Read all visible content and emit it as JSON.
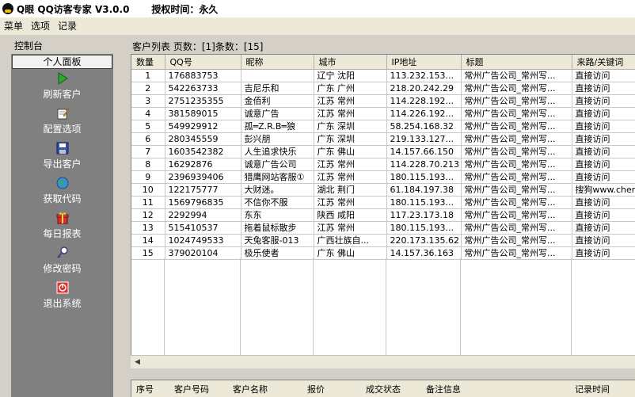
{
  "titlebar": {
    "title": "Q眼 QQ访客专家 V3.0.0",
    "license_label": "授权时间：永久"
  },
  "menu": [
    "菜单",
    "选项",
    "记录"
  ],
  "control_panel": {
    "label": "控制台",
    "header": "个人面板",
    "items": [
      {
        "label": "刷新客户",
        "icon": "play-icon"
      },
      {
        "label": "配置选项",
        "icon": "edit-icon"
      },
      {
        "label": "导出客户",
        "icon": "save-icon"
      },
      {
        "label": "获取代码",
        "icon": "globe-icon"
      },
      {
        "label": "每日报表",
        "icon": "gift-icon"
      },
      {
        "label": "修改密码",
        "icon": "key-icon"
      },
      {
        "label": "退出系统",
        "icon": "exit-icon"
      }
    ]
  },
  "customer_list": {
    "title": "客户列表 页数：[1]条数：[15]",
    "columns": [
      "数量",
      "QQ号",
      "昵称",
      "城市",
      "IP地址",
      "标题",
      "来路/关键词"
    ],
    "rows": [
      [
        "1",
        "176883753",
        "",
        "辽宁 沈阳",
        "113.232.153...",
        "常州广告公司_常州写...",
        "直接访问"
      ],
      [
        "2",
        "542263733",
        "吉尼乐和",
        "广东 广州",
        "218.20.242.29",
        "常州广告公司_常州写...",
        "直接访问"
      ],
      [
        "3",
        "2751235355",
        "金佰利",
        "江苏 常州",
        "114.228.192...",
        "常州广告公司_常州写...",
        "直接访问"
      ],
      [
        "4",
        "381589015",
        "诚意广告",
        "江苏 常州",
        "114.226.192...",
        "常州广告公司_常州写...",
        "直接访问"
      ],
      [
        "5",
        "549929912",
        "孤═Z.R.B═狼",
        "广东 深圳",
        "58.254.168.32",
        "常州广告公司_常州写...",
        "直接访问"
      ],
      [
        "6",
        "280345559",
        "彭兴朋",
        "广东 深圳",
        "219.133.127...",
        "常州广告公司_常州写...",
        "直接访问"
      ],
      [
        "7",
        "1603542382",
        "人生追求快乐",
        "广东 佛山",
        "14.157.66.150",
        "常州广告公司_常州写...",
        "直接访问"
      ],
      [
        "8",
        "16292876",
        "诚意广告公司",
        "江苏 常州",
        "114.228.70.213",
        "常州广告公司_常州写...",
        "直接访问"
      ],
      [
        "9",
        "2396939406",
        "猎鹰网站客服①",
        "江苏 常州",
        "180.115.193...",
        "常州广告公司_常州写...",
        "直接访问"
      ],
      [
        "10",
        "122175777",
        "大财迷。",
        "湖北 荆门",
        "61.184.197.38",
        "常州广告公司_常州写...",
        "搜狗www.cheng"
      ],
      [
        "11",
        "1569796835",
        "不信你不服",
        "江苏 常州",
        "180.115.193...",
        "常州广告公司_常州写...",
        "直接访问"
      ],
      [
        "12",
        "2292994",
        "东东",
        "陕西 咸阳",
        "117.23.173.18",
        "常州广告公司_常州写...",
        "直接访问"
      ],
      [
        "13",
        "515410537",
        "拖着鼠标散步",
        "江苏 常州",
        "180.115.193...",
        "常州广告公司_常州写...",
        "直接访问"
      ],
      [
        "14",
        "1024749533",
        "天兔客服-013",
        "广西壮族自...",
        "220.173.135.62",
        "常州广告公司_常州写...",
        "直接访问"
      ],
      [
        "15",
        "379020104",
        "极乐使者",
        "广东 佛山",
        "14.157.36.163",
        "常州广告公司_常州写...",
        "直接访问"
      ]
    ]
  },
  "records": {
    "columns": [
      "序号",
      "客户号码",
      "客户名称",
      "报价",
      "成交状态",
      "备注信息",
      "记录时间"
    ]
  },
  "colors": {
    "panel_bg": "#808080",
    "window_bg": "#d4d0c8",
    "grid_bg": "#ffffff"
  }
}
